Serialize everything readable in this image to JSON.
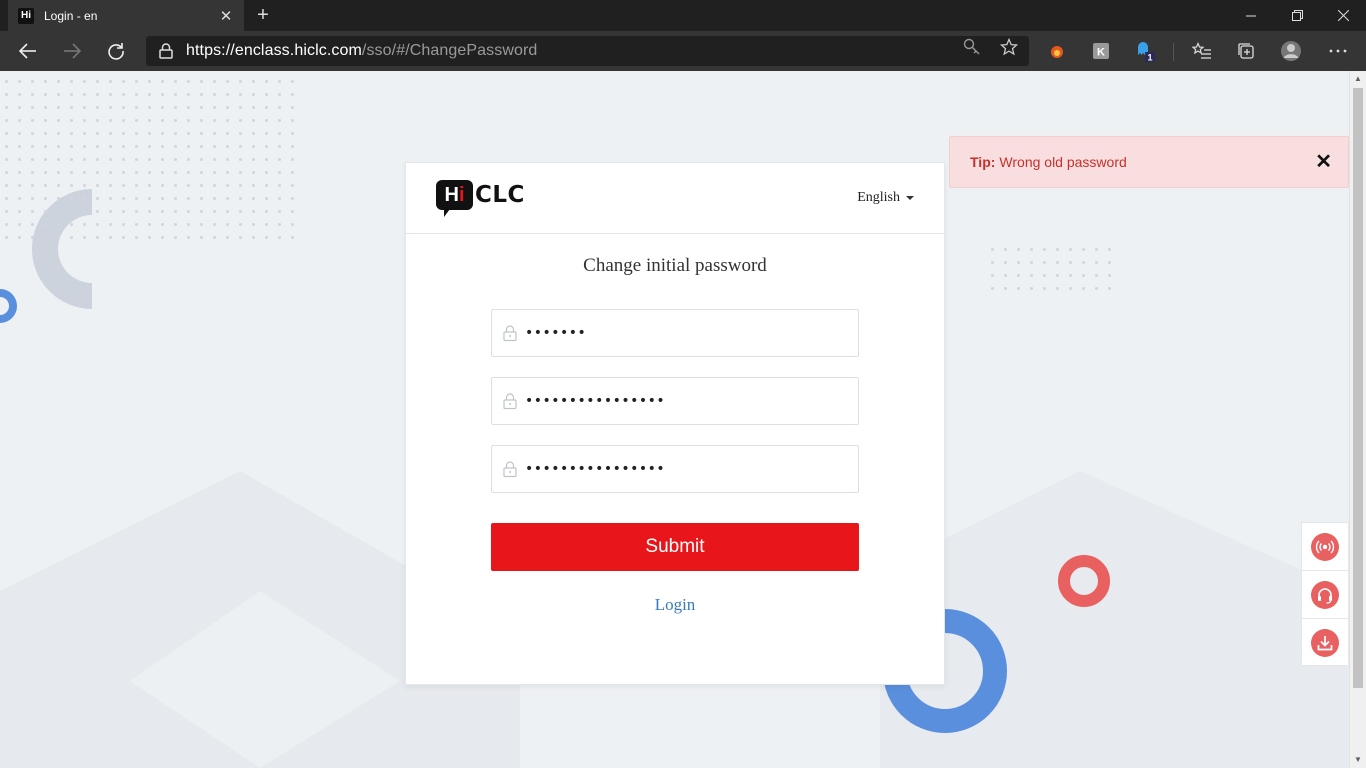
{
  "browser": {
    "tab_title": "Login - en",
    "tab_favicon_text": "Hi",
    "url_host": "https://enclass.hiclc.com",
    "url_path": "/sso/#/ChangePassword",
    "extension_badge": "1"
  },
  "header": {
    "logo_hi": "H",
    "logo_i": "i",
    "logo_clc": "CLC",
    "language": "English"
  },
  "form": {
    "title": "Change initial password",
    "old_password_value": "•••••••",
    "new_password_value": "••••••••••••••••",
    "confirm_password_value": "••••••••••••••••",
    "submit_label": "Submit",
    "login_link": "Login"
  },
  "toast": {
    "label": "Tip:",
    "message": "Wrong old password"
  },
  "side": {
    "items": [
      "live-icon",
      "headset-icon",
      "download-icon"
    ]
  },
  "colors": {
    "brand_red": "#e8161a",
    "toast_bg": "#f8dede",
    "link_blue": "#3a7abf",
    "side_icon_bg": "#e8605f"
  }
}
